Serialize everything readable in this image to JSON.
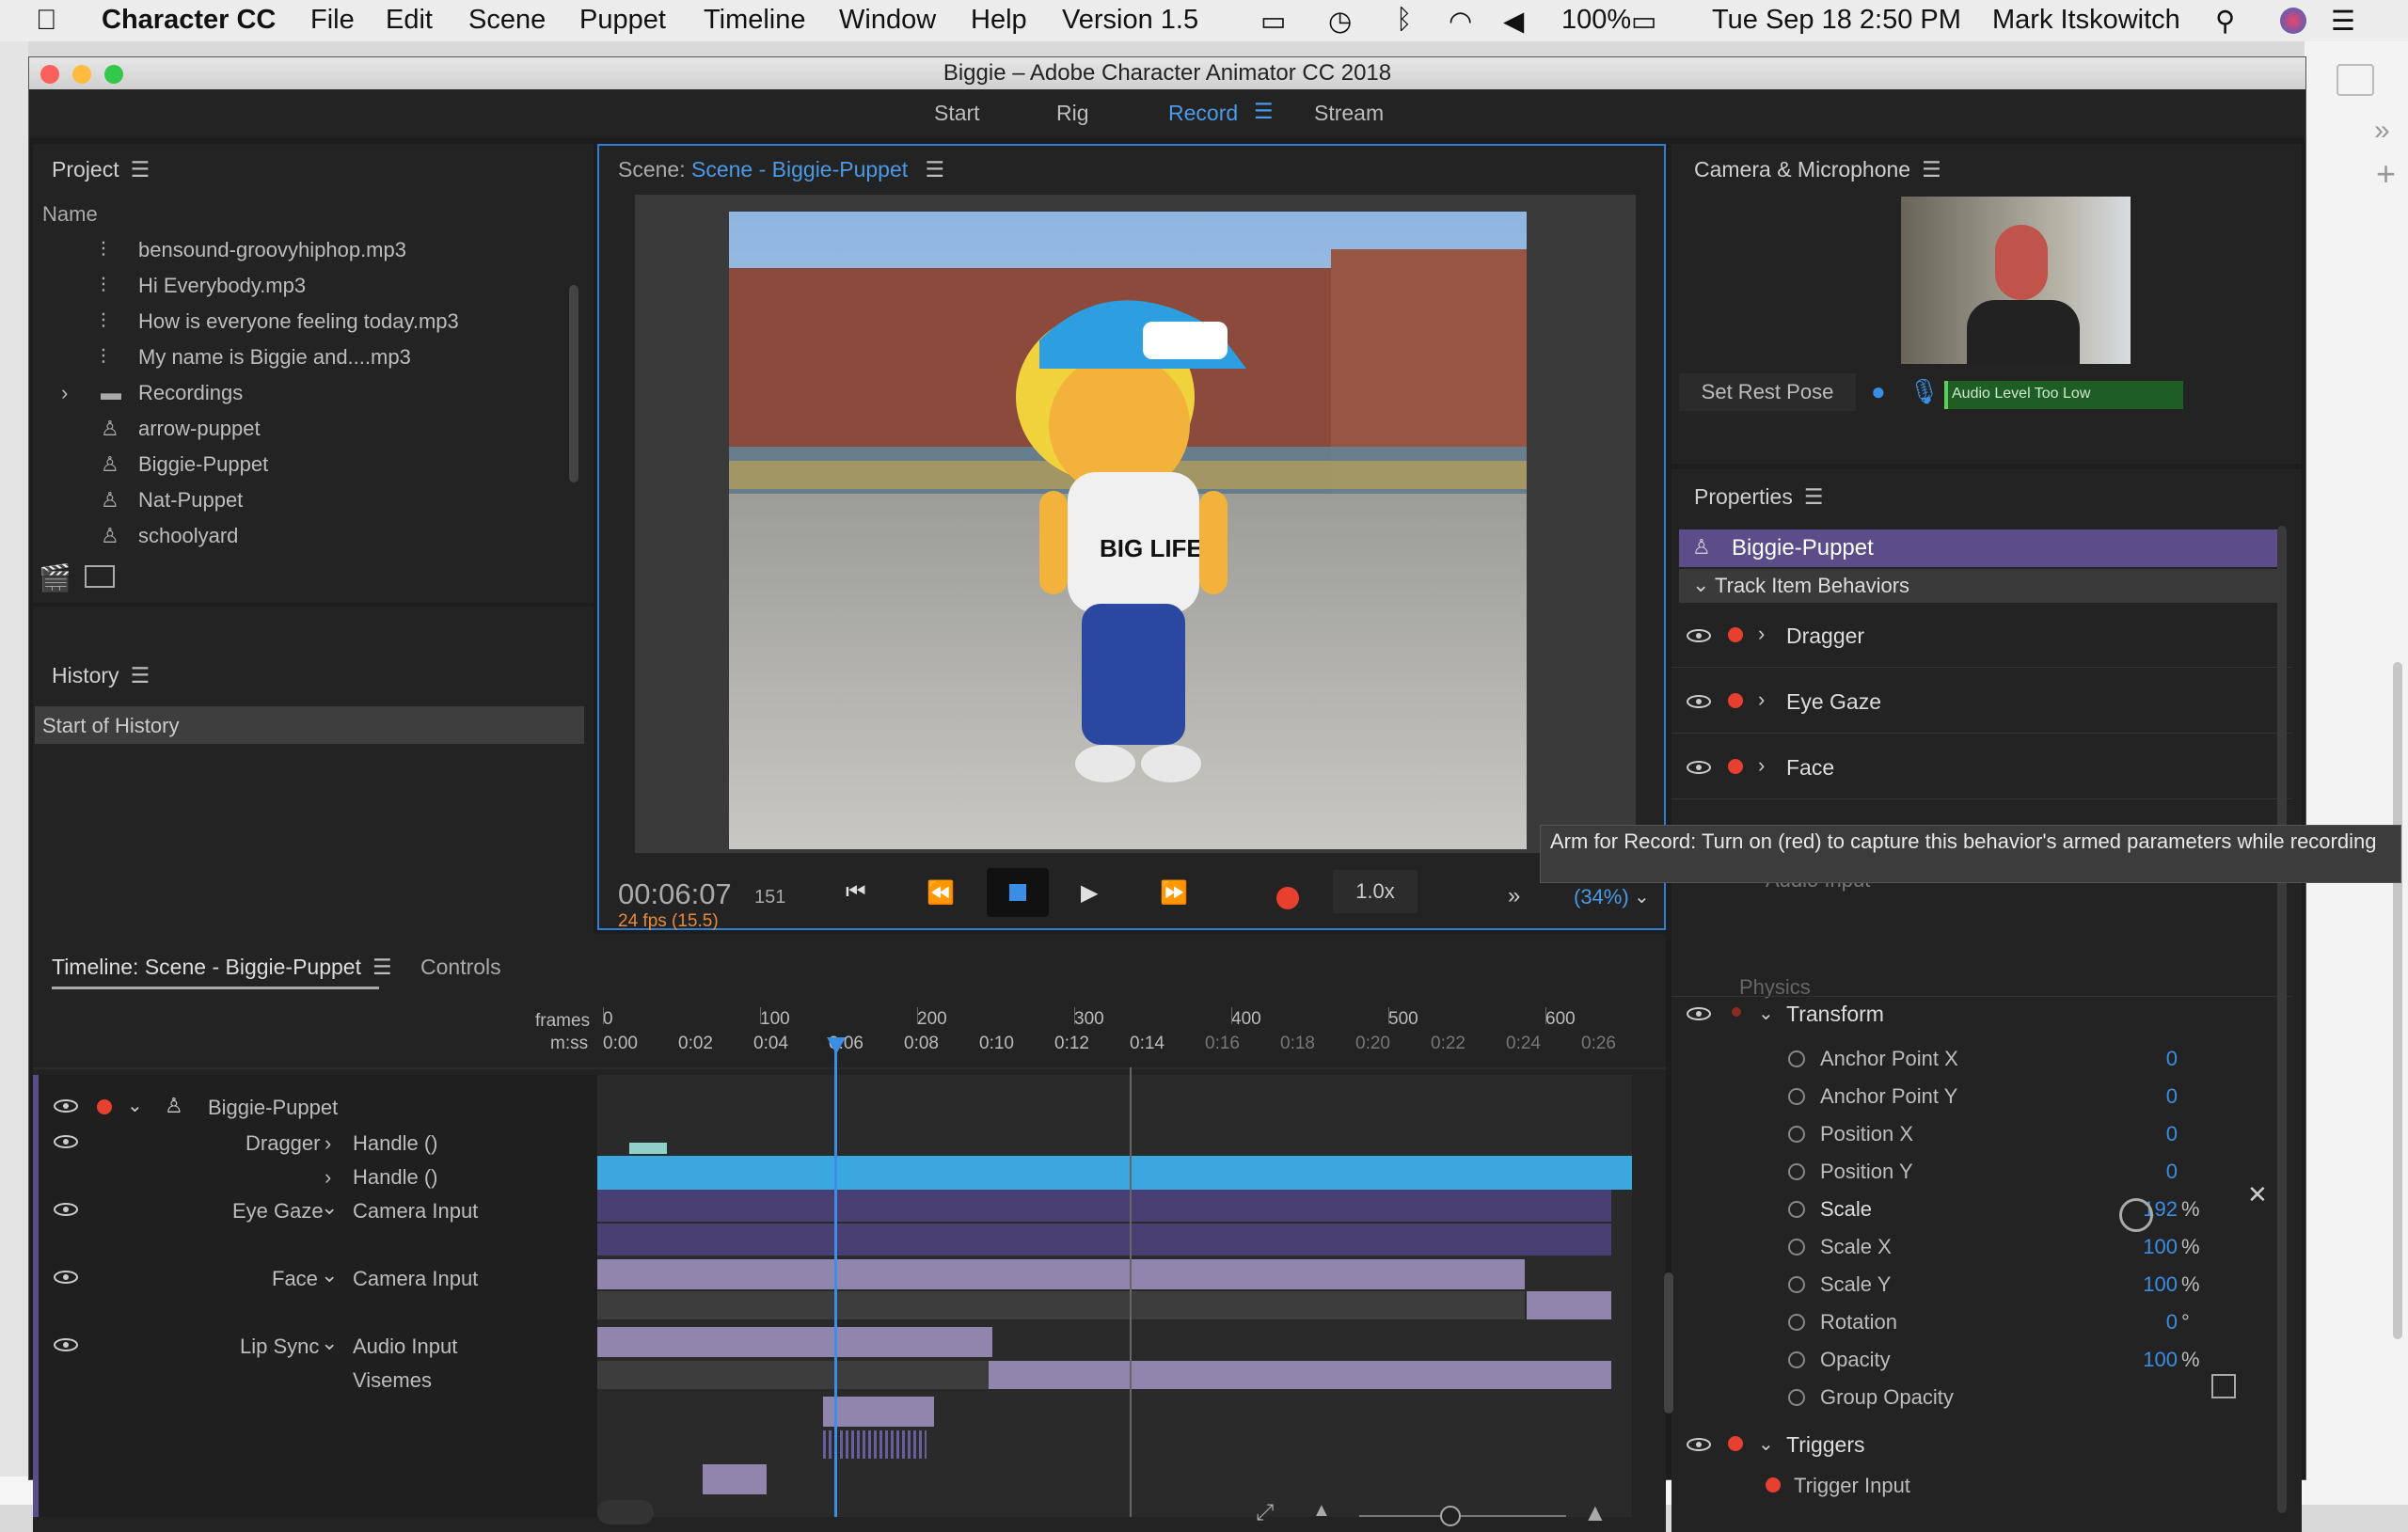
{
  "menubar": {
    "app_name": "Character CC",
    "menus": [
      "File",
      "Edit",
      "Scene",
      "Puppet",
      "Timeline",
      "Window",
      "Help",
      "Version 1.5"
    ],
    "battery": "100%",
    "datetime": "Tue Sep 18  2:50 PM",
    "user": "Mark Itskowitch"
  },
  "window": {
    "title": "Biggie – Adobe Character Animator CC 2018",
    "workspaces": [
      "Start",
      "Rig",
      "Record",
      "Stream"
    ],
    "active_workspace": "Record"
  },
  "project": {
    "title": "Project",
    "column_name": "Name",
    "items": [
      {
        "label": "bensound-groovyhiphop.mp3",
        "icon": "audio-icon"
      },
      {
        "label": "Hi Everybody.mp3",
        "icon": "audio-icon"
      },
      {
        "label": "How is everyone feeling today.mp3",
        "icon": "audio-icon"
      },
      {
        "label": "My name is Biggie and....mp3",
        "icon": "audio-icon"
      },
      {
        "label": "Recordings",
        "icon": "folder-icon"
      },
      {
        "label": "arrow-puppet",
        "icon": "puppet-icon"
      },
      {
        "label": "Biggie-Puppet",
        "icon": "puppet-icon"
      },
      {
        "label": "Nat-Puppet",
        "icon": "puppet-icon"
      },
      {
        "label": "schoolyard",
        "icon": "puppet-icon"
      }
    ]
  },
  "history": {
    "title": "History",
    "items": [
      "Start of History"
    ]
  },
  "scene": {
    "prefix": "Scene:",
    "name": "Scene - Biggie-Puppet",
    "timecode": "00:06:07",
    "frame": "151",
    "fps": "24 fps (15.5)",
    "speed": "1.0x",
    "zoom": "(34%)",
    "tshirt_text": "BIG LIFE"
  },
  "camera": {
    "title": "Camera & Microphone",
    "set_rest_pose": "Set Rest Pose",
    "audio_level": "Audio Level Too Low"
  },
  "properties": {
    "title": "Properties",
    "puppet": "Biggie-Puppet",
    "section": "Track Item Behaviors",
    "behaviors": [
      "Dragger",
      "Eye Gaze",
      "Face",
      "Lip Sync"
    ],
    "lipsync_child": "Audio Input",
    "physics": "Physics",
    "transform": "Transform",
    "transform_props": [
      {
        "label": "Anchor Point X",
        "value": "0",
        "unit": ""
      },
      {
        "label": "Anchor Point Y",
        "value": "0",
        "unit": ""
      },
      {
        "label": "Position X",
        "value": "0",
        "unit": ""
      },
      {
        "label": "Position Y",
        "value": "0",
        "unit": ""
      },
      {
        "label": "Scale",
        "value": "192",
        "unit": "%"
      },
      {
        "label": "Scale X",
        "value": "100",
        "unit": "%"
      },
      {
        "label": "Scale Y",
        "value": "100",
        "unit": "%"
      },
      {
        "label": "Rotation",
        "value": "0",
        "unit": "°"
      },
      {
        "label": "Opacity",
        "value": "100",
        "unit": "%"
      },
      {
        "label": "Group Opacity",
        "value": "",
        "unit": ""
      }
    ],
    "triggers": "Triggers",
    "trigger_input": "Trigger Input"
  },
  "tooltip": "Arm for Record: Turn on (red) to capture this behavior's armed parameters while recording",
  "timeline": {
    "tab": "Timeline: Scene - Biggie-Puppet",
    "controls_tab": "Controls",
    "frames_label": "frames",
    "mss_label": "m:ss",
    "frame_ticks": [
      "0",
      "100",
      "200",
      "300",
      "400",
      "500",
      "600"
    ],
    "time_ticks": [
      "0:00",
      "0:02",
      "0:04",
      "0:06",
      "0:08",
      "0:10",
      "0:12",
      "0:14",
      "0:16",
      "0:18",
      "0:20",
      "0:22",
      "0:24",
      "0:26"
    ],
    "tracks": {
      "puppet": "Biggie-Puppet",
      "dragger": "Dragger",
      "handle1": "Handle ()",
      "handle2": "Handle ()",
      "eyegaze": "Eye Gaze",
      "eyegaze_input": "Camera Input",
      "face": "Face",
      "face_input": "Camera Input",
      "lipsync": "Lip Sync",
      "lipsync_input": "Audio Input",
      "visemes": "Visemes"
    }
  },
  "colors": {
    "accent": "#3a8ee6",
    "record_red": "#e8402e",
    "puppet_purple": "#5b4d8a",
    "track_blue": "#3aa8de"
  }
}
